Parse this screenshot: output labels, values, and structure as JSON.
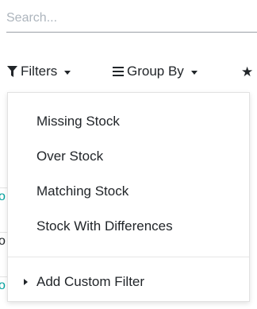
{
  "search": {
    "placeholder": "Search...",
    "value": ""
  },
  "toolbar": {
    "filters_label": "Filters",
    "group_by_label": "Group By"
  },
  "filters_menu": {
    "items": [
      {
        "label": "Missing Stock"
      },
      {
        "label": "Over Stock"
      },
      {
        "label": "Matching Stock"
      },
      {
        "label": "Stock With Differences"
      }
    ],
    "custom_filter_label": "Add Custom Filter"
  },
  "list_fragments": [
    "o",
    "o",
    "o"
  ],
  "colors": {
    "link": "#00A09D",
    "text": "#212529",
    "placeholder": "#adb5bd"
  },
  "icons": {
    "filters": "funnel-icon",
    "group_by": "bars-icon",
    "favorites": "star-icon"
  }
}
